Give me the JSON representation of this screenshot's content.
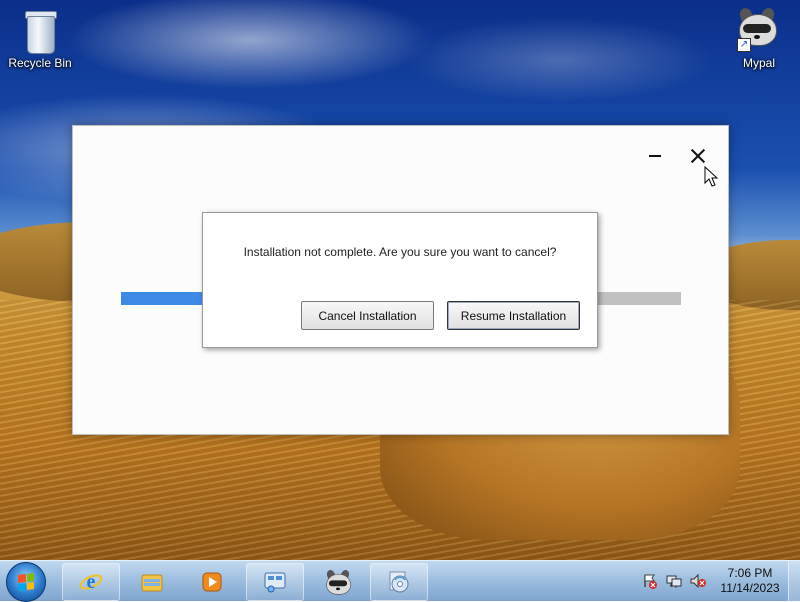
{
  "desktop": {
    "icons": [
      {
        "label": "Recycle Bin",
        "icon": "recycle-bin-icon"
      },
      {
        "label": "Mypal",
        "icon": "raccoon-icon"
      }
    ]
  },
  "installer": {
    "progress": 0.15,
    "controls": {
      "minimize": "minimize-icon",
      "close": "close-icon"
    }
  },
  "dialog": {
    "message": "Installation not complete. Are you sure you want to cancel?",
    "cancel_label": "Cancel Installation",
    "resume_label": "Resume Installation"
  },
  "taskbar": {
    "pinned": [
      {
        "name": "Internet Explorer",
        "icon": "internet-explorer-icon"
      },
      {
        "name": "Windows Explorer",
        "icon": "folder-icon"
      },
      {
        "name": "Windows Media Player",
        "icon": "media-player-icon"
      },
      {
        "name": "Control Panel",
        "icon": "control-panel-icon"
      },
      {
        "name": "Mypal",
        "icon": "raccoon-icon"
      },
      {
        "name": "Installer",
        "icon": "installer-disc-icon"
      }
    ],
    "tray_icons": [
      "action-center-icon",
      "network-icon",
      "volume-muted-icon"
    ],
    "time": "7:06 PM",
    "date": "11/14/2023"
  },
  "colors": {
    "accent": "#3f89e6",
    "progress_track": "#c1c1c1"
  }
}
